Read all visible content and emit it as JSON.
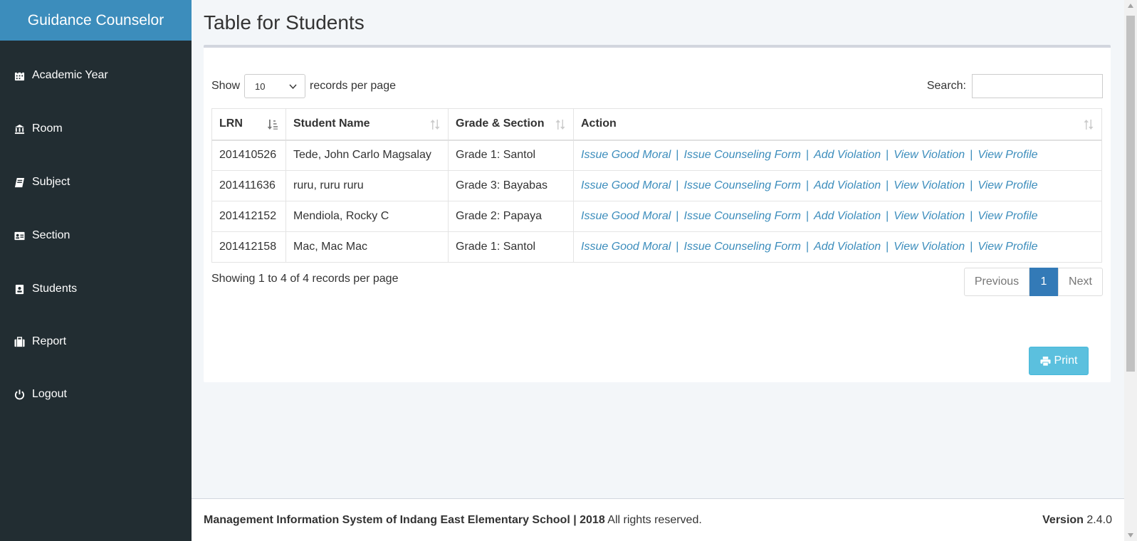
{
  "app": {
    "brand": "Guidance Counselor"
  },
  "sidebar": {
    "items": [
      {
        "label": "Academic Year",
        "icon": "calendar-icon"
      },
      {
        "label": "Room",
        "icon": "bank-icon"
      },
      {
        "label": "Subject",
        "icon": "book-icon"
      },
      {
        "label": "Section",
        "icon": "id-card-icon"
      },
      {
        "label": "Students",
        "icon": "address-book-icon"
      },
      {
        "label": "Report",
        "icon": "briefcase-icon"
      },
      {
        "label": "Logout",
        "icon": "power-icon"
      }
    ]
  },
  "page": {
    "title": "Table for Students"
  },
  "table_controls": {
    "show_label": "Show",
    "page_size": "10",
    "records_label": "records per page",
    "search_label": "Search:",
    "search_value": ""
  },
  "table": {
    "columns": [
      "LRN",
      "Student Name",
      "Grade & Section",
      "Action"
    ],
    "actions": [
      "Issue Good Moral",
      "Issue Counseling Form",
      "Add Violation",
      "View Violation",
      "View Profile"
    ],
    "rows": [
      {
        "lrn": "201410526",
        "name": "Tede,  John Carlo Magsalay",
        "grade": "Grade 1:  Santol"
      },
      {
        "lrn": "201411636",
        "name": "ruru,  ruru ruru",
        "grade": "Grade 3:  Bayabas"
      },
      {
        "lrn": "201412152",
        "name": "Mendiola,  Rocky C",
        "grade": "Grade 2:  Papaya"
      },
      {
        "lrn": "201412158",
        "name": "Mac,  Mac Mac",
        "grade": "Grade 1:  Santol"
      }
    ]
  },
  "pagination": {
    "info_prefix": "Showing",
    "info_start": "1",
    "info_to": "to",
    "info_end": "4",
    "info_of": "of",
    "info_total": "4",
    "info_suffix": "records per page",
    "previous": "Previous",
    "current_page": "1",
    "next": "Next"
  },
  "print_label": "Print",
  "footer": {
    "left_bold": "Management Information System of Indang East Elementary School | 2018",
    "left_rest": "All rights reserved.",
    "version_label": "Version",
    "version_value": "2.4.0"
  },
  "colors": {
    "sidebar_bg": "#222d32",
    "brand_bg": "#3c8dbc",
    "link": "#3c8dbc",
    "active_page": "#337ab7",
    "print_button": "#5bc0de"
  }
}
